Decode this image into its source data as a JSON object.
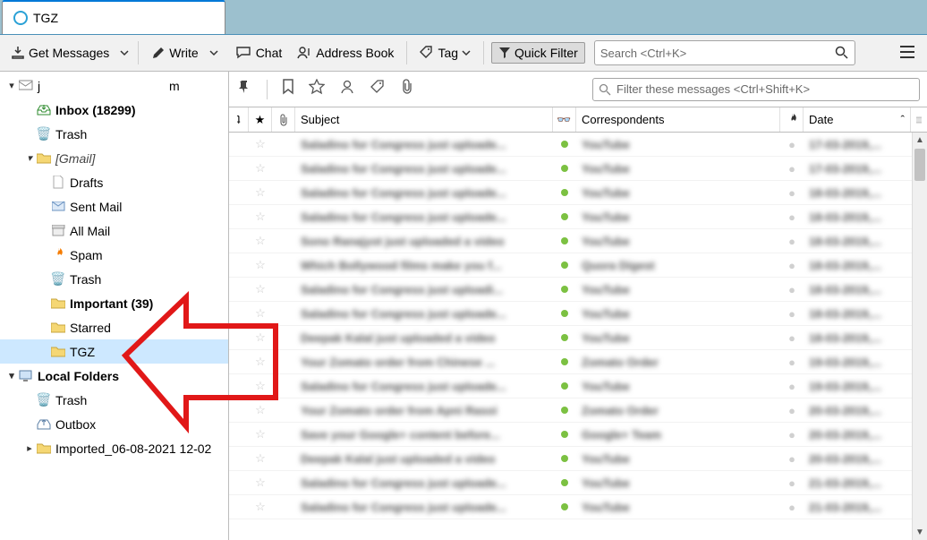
{
  "tab": {
    "title": "TGZ"
  },
  "toolbar": {
    "get_messages": "Get Messages",
    "write": "Write",
    "chat": "Chat",
    "address_book": "Address Book",
    "tag": "Tag",
    "quick_filter": "Quick Filter",
    "search_placeholder": "Search <Ctrl+K>"
  },
  "filterbar": {
    "placeholder": "Filter these messages <Ctrl+Shift+K>"
  },
  "columns": {
    "subject": "Subject",
    "correspondents": "Correspondents",
    "date": "Date"
  },
  "sidebar": {
    "account_label": "j                                     m",
    "inbox": "Inbox (18299)",
    "trash": "Trash",
    "gmail": "[Gmail]",
    "drafts": "Drafts",
    "sent": "Sent Mail",
    "all": "All Mail",
    "spam": "Spam",
    "gtrash": "Trash",
    "important": "Important (39)",
    "starred": "Starred",
    "tgz": "TGZ",
    "local": "Local Folders",
    "ltrash": "Trash",
    "outbox": "Outbox",
    "imported": "Imported_06-08-2021 12-02"
  },
  "messages": [
    {
      "subject": "Saladino for Congress just uploade...",
      "from": "YouTube",
      "date": "17-03-2019,..."
    },
    {
      "subject": "Saladino for Congress just uploade...",
      "from": "YouTube",
      "date": "17-03-2019,..."
    },
    {
      "subject": "Saladino for Congress just uploade...",
      "from": "YouTube",
      "date": "18-03-2019,..."
    },
    {
      "subject": "Saladino for Congress just uploade...",
      "from": "YouTube",
      "date": "18-03-2019,..."
    },
    {
      "subject": "Sono Ranajyot just uploaded a video",
      "from": "YouTube",
      "date": "18-03-2019,..."
    },
    {
      "subject": "Which Bollywood films make you f...",
      "from": "Quora Digest",
      "date": "18-03-2019,..."
    },
    {
      "subject": "Saladino for Congress just uploadi...",
      "from": "YouTube",
      "date": "18-03-2019,..."
    },
    {
      "subject": "Saladino for Congress just uploade...",
      "from": "YouTube",
      "date": "18-03-2019,..."
    },
    {
      "subject": "Deepak Kalal just uploaded a video",
      "from": "YouTube",
      "date": "18-03-2019,..."
    },
    {
      "subject": "Your Zomato order from Chinese ...",
      "from": "Zomato Order",
      "date": "19-03-2019,..."
    },
    {
      "subject": "Saladino for Congress just uploade...",
      "from": "YouTube",
      "date": "19-03-2019,..."
    },
    {
      "subject": "Your Zomato order from Apni Rasoi",
      "from": "Zomato Order",
      "date": "20-03-2019,..."
    },
    {
      "subject": "Save your Google+ content before...",
      "from": "Google+ Team",
      "date": "20-03-2019,..."
    },
    {
      "subject": "Deepak Kalal just uploaded a video",
      "from": "YouTube",
      "date": "20-03-2019,..."
    },
    {
      "subject": "Saladino for Congress just uploade...",
      "from": "YouTube",
      "date": "21-03-2019,..."
    },
    {
      "subject": "Saladino for Congress just uploade...",
      "from": "YouTube",
      "date": "21-03-2019,..."
    }
  ]
}
